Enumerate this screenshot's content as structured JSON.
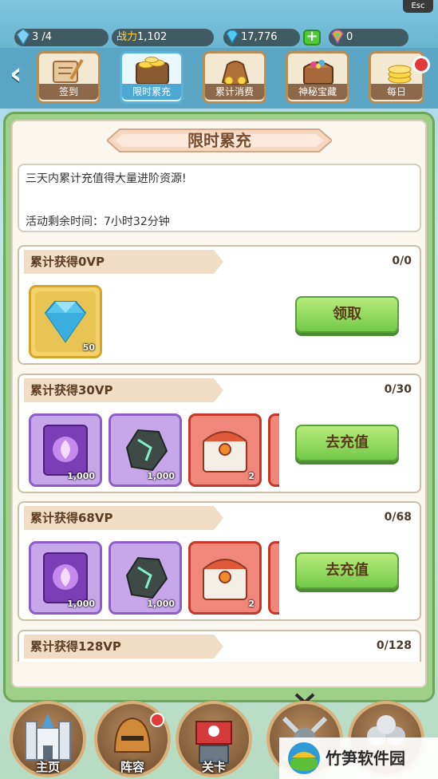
{
  "system": {
    "esc_label": "Esc"
  },
  "resources": {
    "stamina": "3 /4",
    "power_label": "战力",
    "power_value": "1,102",
    "gems": "17,776",
    "rainbow": "0"
  },
  "tabs": [
    {
      "label": "签到",
      "icon": "sign-in-icon"
    },
    {
      "label": "限时累充",
      "icon": "coin-stack-icon",
      "active": true
    },
    {
      "label": "累计消费",
      "icon": "money-bag-icon"
    },
    {
      "label": "神秘宝藏",
      "icon": "treasure-chest-icon"
    },
    {
      "label": "每日",
      "icon": "daily-coins-icon"
    }
  ],
  "panel": {
    "title": "限时累充",
    "description": "三天内累计充值得大量进阶资源!",
    "time_left": "活动剩余时间：7小时32分钟"
  },
  "rows": [
    {
      "title": "累计获得0VP",
      "progress": "0/0",
      "button": "领取",
      "items": [
        {
          "icon": "diamond-icon",
          "qty": "50"
        }
      ]
    },
    {
      "title": "累计获得30VP",
      "progress": "0/30",
      "button": "去充值",
      "items": [
        {
          "icon": "spellbook-icon",
          "qty": "1,000"
        },
        {
          "icon": "ore-stone-icon",
          "qty": "1,000"
        },
        {
          "icon": "red-chest-icon",
          "qty": "2"
        }
      ]
    },
    {
      "title": "累计获得68VP",
      "progress": "0/68",
      "button": "去充值",
      "items": [
        {
          "icon": "spellbook-icon",
          "qty": "1,000"
        },
        {
          "icon": "ore-stone-icon",
          "qty": "1,000"
        },
        {
          "icon": "red-chest-icon",
          "qty": "2"
        }
      ]
    },
    {
      "title": "累计获得128VP",
      "progress": "0/128"
    }
  ],
  "nav": [
    {
      "label": "主页",
      "icon": "castle-icon"
    },
    {
      "label": "阵容",
      "icon": "helmet-icon"
    },
    {
      "label": "关卡",
      "icon": "skull-flag-icon"
    },
    {
      "label": "",
      "icon": "crossed-swords-icon"
    },
    {
      "label": "",
      "icon": "orbs-icon"
    }
  ],
  "watermark": {
    "text": "竹笋软件园"
  },
  "colors": {
    "button_green": "#74c94a",
    "title_brown": "#7a4e2d",
    "panel_green": "#9fd08a",
    "purple_frame": "#a77bd6",
    "red_frame": "#e05a4a",
    "gold_frame": "#e6c04a"
  }
}
